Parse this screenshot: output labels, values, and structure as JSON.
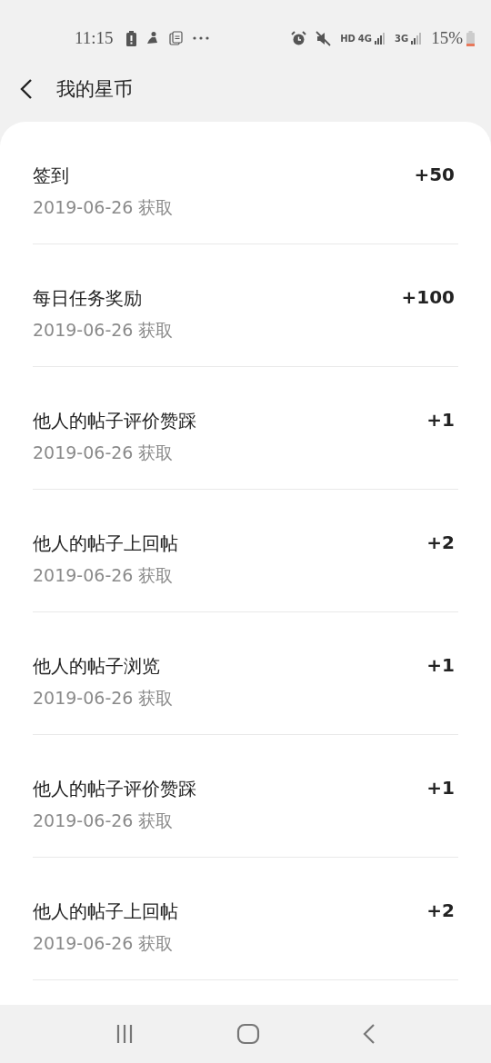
{
  "status_bar": {
    "time": "11:15",
    "hd": "HD",
    "network_1": "4G",
    "network_2": "3G",
    "battery": "15%"
  },
  "header": {
    "title": "我的星币"
  },
  "records": [
    {
      "title": "签到",
      "date": "2019-06-26 获取",
      "amount": "+50"
    },
    {
      "title": "每日任务奖励",
      "date": "2019-06-26 获取",
      "amount": "+100"
    },
    {
      "title": "他人的帖子评价赞踩",
      "date": "2019-06-26 获取",
      "amount": "+1"
    },
    {
      "title": "他人的帖子上回帖",
      "date": "2019-06-26 获取",
      "amount": "+2"
    },
    {
      "title": "他人的帖子浏览",
      "date": "2019-06-26 获取",
      "amount": "+1"
    },
    {
      "title": "他人的帖子评价赞踩",
      "date": "2019-06-26 获取",
      "amount": "+1"
    },
    {
      "title": "他人的帖子上回帖",
      "date": "2019-06-26 获取",
      "amount": "+2"
    }
  ]
}
